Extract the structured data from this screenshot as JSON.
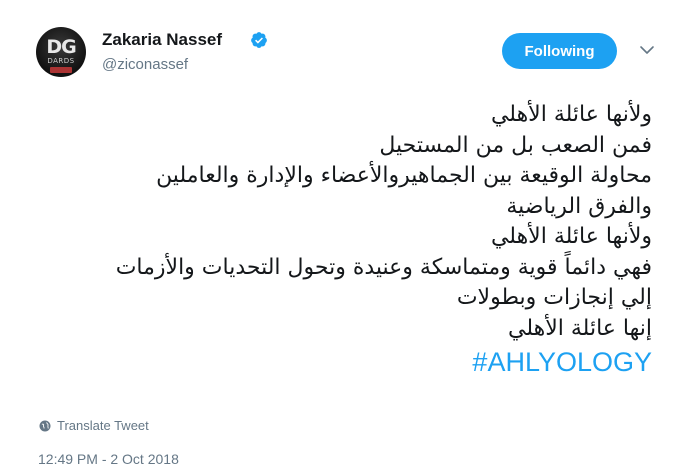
{
  "author": {
    "name": "Zakaria Nassef",
    "handle": "@ziconassef",
    "avatar_text": "DG",
    "avatar_subtext": "DARDS"
  },
  "follow_button": {
    "label": "Following"
  },
  "colors": {
    "accent": "#1da1f2",
    "secondary_text": "#657786",
    "primary_text": "#14171a"
  },
  "tweet": {
    "lines": [
      "ولأنها عائلة الأهلي",
      "فمن الصعب بل من المستحيل",
      "محاولة الوقيعة بين الجماهيروالأعضاء والإدارة والعاملين",
      "والفرق الرياضية",
      "ولأنها عائلة الأهلي",
      "فهي دائماً قوية ومتماسكة وعنيدة وتحول التحديات والأزمات",
      " إلي إنجازات وبطولات",
      "إنها عائلة الأهلي"
    ],
    "hashtag": "#AHLYOLOGY"
  },
  "translate": {
    "label": "Translate Tweet"
  },
  "timestamp": "12:49 PM - 2 Oct 2018",
  "icons": {
    "verified": "verified-badge-icon",
    "caret": "chevron-down-icon",
    "globe": "globe-icon"
  }
}
